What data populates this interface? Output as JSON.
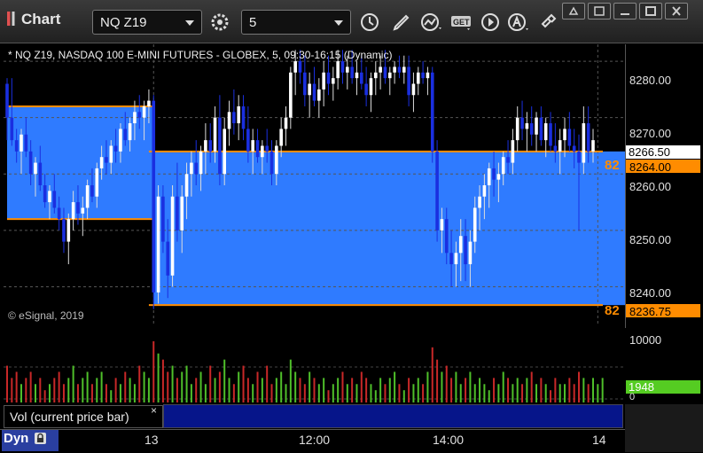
{
  "toolbar": {
    "title": "Chart",
    "symbol": "NQ Z19",
    "interval": "5",
    "buttons": [
      "clock-icon",
      "pencil-icon",
      "study-icon",
      "get-icon",
      "play-icon",
      "alert-icon",
      "link-icon"
    ]
  },
  "chart_info": "* NQ Z19, NASDAQ 100 E-MINI FUTURES - GLOBEX, 5, 09:30-16:15 (Dynamic)",
  "copyright": "© eSignal, 2019",
  "price_axis": {
    "ticks": [
      "8280.00",
      "8270.00",
      "8260.00",
      "8250.00",
      "8240.00"
    ],
    "tags": {
      "last": "8266.50",
      "upper_level": "8264.00",
      "lower_level": "8236.75"
    },
    "level_prefix": "82"
  },
  "volume_axis": {
    "ticks": [
      "10000",
      "0"
    ],
    "current": "1948"
  },
  "volume_legend": "Vol (current price bar)",
  "close_x": "×",
  "time_axis": [
    "13",
    "12:00",
    "14:00",
    "14"
  ],
  "dyn_label": "Dyn",
  "colors": {
    "zone": "#2f7bff",
    "level": "#ff8c00",
    "up": "#ffffff",
    "down": "#1a2fe0",
    "vol_up": "#4fbf2a",
    "vol_down": "#c82828"
  },
  "chart_data": {
    "type": "candlestick",
    "ylim": [
      8233,
      8283
    ],
    "levels": [
      8272,
      8264,
      8252,
      8236.75
    ],
    "zones": [
      {
        "from_bar": 0,
        "to_bar": 31,
        "top": 8272,
        "bottom": 8252
      },
      {
        "from_bar": 31,
        "to_bar": 131,
        "top": 8264,
        "bottom": 8236.75
      }
    ],
    "candles": [
      [
        8276,
        8277,
        8266,
        8270
      ],
      [
        8270,
        8277,
        8265,
        8266
      ],
      [
        8266,
        8268,
        8262,
        8264
      ],
      [
        8264,
        8268,
        8260,
        8267
      ],
      [
        8267,
        8270,
        8263,
        8264
      ],
      [
        8264,
        8266,
        8258,
        8260
      ],
      [
        8260,
        8263,
        8256,
        8262
      ],
      [
        8262,
        8265,
        8257,
        8258
      ],
      [
        8258,
        8260,
        8254,
        8255
      ],
      [
        8255,
        8258,
        8252,
        8257
      ],
      [
        8257,
        8260,
        8253,
        8254
      ],
      [
        8254,
        8256,
        8250,
        8252
      ],
      [
        8252,
        8254,
        8246,
        8248
      ],
      [
        8248,
        8253,
        8244,
        8252
      ],
      [
        8252,
        8257,
        8250,
        8255
      ],
      [
        8255,
        8258,
        8251,
        8253
      ],
      [
        8253,
        8256,
        8249,
        8254
      ],
      [
        8254,
        8259,
        8252,
        8258
      ],
      [
        8258,
        8261,
        8255,
        8256
      ],
      [
        8256,
        8262,
        8254,
        8261
      ],
      [
        8261,
        8265,
        8259,
        8263
      ],
      [
        8263,
        8266,
        8260,
        8262
      ],
      [
        8262,
        8266,
        8260,
        8265
      ],
      [
        8265,
        8268,
        8262,
        8264
      ],
      [
        8264,
        8269,
        8262,
        8268
      ],
      [
        8268,
        8271,
        8265,
        8266
      ],
      [
        8266,
        8270,
        8264,
        8269
      ],
      [
        8269,
        8273,
        8266,
        8271
      ],
      [
        8271,
        8274,
        8268,
        8270
      ],
      [
        8270,
        8273,
        8266,
        8272
      ],
      [
        8272,
        8275,
        8269,
        8273
      ],
      [
        8273,
        8274,
        8236,
        8239
      ],
      [
        8239,
        8258,
        8237,
        8256
      ],
      [
        8256,
        8258,
        8246,
        8248
      ],
      [
        8248,
        8252,
        8238,
        8242
      ],
      [
        8242,
        8258,
        8240,
        8256
      ],
      [
        8256,
        8262,
        8248,
        8250
      ],
      [
        8250,
        8258,
        8246,
        8256
      ],
      [
        8256,
        8262,
        8252,
        8260
      ],
      [
        8260,
        8264,
        8256,
        8262
      ],
      [
        8262,
        8266,
        8258,
        8260
      ],
      [
        8260,
        8265,
        8257,
        8264
      ],
      [
        8264,
        8269,
        8260,
        8266
      ],
      [
        8266,
        8269,
        8262,
        8264
      ],
      [
        8264,
        8272,
        8262,
        8270
      ],
      [
        8270,
        8274,
        8258,
        8260
      ],
      [
        8260,
        8270,
        8258,
        8268
      ],
      [
        8268,
        8273,
        8265,
        8271
      ],
      [
        8271,
        8275,
        8267,
        8269
      ],
      [
        8269,
        8274,
        8266,
        8272
      ],
      [
        8272,
        8274,
        8266,
        8268
      ],
      [
        8268,
        8272,
        8262,
        8264
      ],
      [
        8264,
        8268,
        8260,
        8266
      ],
      [
        8266,
        8268,
        8262,
        8263
      ],
      [
        8263,
        8266,
        8260,
        8265
      ],
      [
        8265,
        8268,
        8262,
        8264
      ],
      [
        8264,
        8266,
        8258,
        8260
      ],
      [
        8260,
        8266,
        8258,
        8265
      ],
      [
        8265,
        8270,
        8263,
        8268
      ],
      [
        8268,
        8272,
        8265,
        8270
      ],
      [
        8270,
        8279,
        8268,
        8278
      ],
      [
        8278,
        8282,
        8274,
        8280
      ],
      [
        8280,
        8282,
        8276,
        8278
      ],
      [
        8278,
        8281,
        8272,
        8274
      ],
      [
        8274,
        8278,
        8270,
        8276
      ],
      [
        8276,
        8279,
        8272,
        8273
      ],
      [
        8273,
        8277,
        8270,
        8275
      ],
      [
        8275,
        8280,
        8272,
        8278
      ],
      [
        8278,
        8281,
        8274,
        8276
      ],
      [
        8276,
        8279,
        8273,
        8277
      ],
      [
        8277,
        8282,
        8275,
        8280
      ],
      [
        8280,
        8282,
        8276,
        8278
      ],
      [
        8278,
        8281,
        8275,
        8279
      ],
      [
        8279,
        8282,
        8276,
        8277
      ],
      [
        8277,
        8280,
        8274,
        8278
      ],
      [
        8278,
        8281,
        8275,
        8276
      ],
      [
        8276,
        8279,
        8272,
        8274
      ],
      [
        8274,
        8278,
        8271,
        8277
      ],
      [
        8277,
        8280,
        8274,
        8278
      ],
      [
        8278,
        8281,
        8275,
        8279
      ],
      [
        8279,
        8282,
        8276,
        8277
      ],
      [
        8277,
        8279,
        8274,
        8278
      ],
      [
        8278,
        8280,
        8276,
        8279
      ],
      [
        8279,
        8281,
        8277,
        8278
      ],
      [
        8278,
        8281,
        8276,
        8279
      ],
      [
        8279,
        8281,
        8272,
        8274
      ],
      [
        8274,
        8278,
        8271,
        8276
      ],
      [
        8276,
        8279,
        8274,
        8278
      ],
      [
        8278,
        8280,
        8276,
        8277
      ],
      [
        8277,
        8279,
        8274,
        8278
      ],
      [
        8278,
        8279,
        8262,
        8264
      ],
      [
        8264,
        8266,
        8248,
        8250
      ],
      [
        8250,
        8254,
        8246,
        8252
      ],
      [
        8252,
        8254,
        8244,
        8246
      ],
      [
        8246,
        8250,
        8240,
        8244
      ],
      [
        8244,
        8248,
        8240,
        8246
      ],
      [
        8246,
        8252,
        8241,
        8249
      ],
      [
        8249,
        8252,
        8241,
        8244
      ],
      [
        8244,
        8250,
        8240,
        8248
      ],
      [
        8248,
        8256,
        8246,
        8254
      ],
      [
        8254,
        8258,
        8250,
        8256
      ],
      [
        8256,
        8260,
        8252,
        8258
      ],
      [
        8258,
        8262,
        8254,
        8261
      ],
      [
        8261,
        8264,
        8256,
        8259
      ],
      [
        8259,
        8262,
        8255,
        8260
      ],
      [
        8260,
        8264,
        8258,
        8263
      ],
      [
        8263,
        8266,
        8260,
        8262
      ],
      [
        8262,
        8268,
        8260,
        8266
      ],
      [
        8266,
        8272,
        8264,
        8270
      ],
      [
        8270,
        8273,
        8266,
        8268
      ],
      [
        8268,
        8271,
        8264,
        8269
      ],
      [
        8269,
        8272,
        8265,
        8267
      ],
      [
        8267,
        8271,
        8264,
        8270
      ],
      [
        8270,
        8272,
        8265,
        8266
      ],
      [
        8266,
        8270,
        8263,
        8269
      ],
      [
        8269,
        8271,
        8264,
        8265
      ],
      [
        8265,
        8269,
        8262,
        8264
      ],
      [
        8264,
        8268,
        8260,
        8266
      ],
      [
        8266,
        8270,
        8263,
        8268
      ],
      [
        8268,
        8271,
        8264,
        8265
      ],
      [
        8265,
        8268,
        8261,
        8264
      ],
      [
        8264,
        8267,
        8250,
        8262
      ],
      [
        8262,
        8272,
        8260,
        8269
      ],
      [
        8269,
        8272,
        8262,
        8264
      ],
      [
        8264,
        8268,
        8262,
        8266
      ]
    ],
    "volume": [
      6,
      4,
      5,
      3,
      4,
      5,
      3,
      4,
      2,
      3,
      4,
      5,
      3,
      4,
      6,
      3,
      4,
      5,
      3,
      4,
      5,
      3,
      2,
      4,
      3,
      5,
      4,
      3,
      6,
      5,
      4,
      10,
      8,
      7,
      5,
      6,
      4,
      5,
      6,
      3,
      4,
      5,
      3,
      6,
      4,
      5,
      7,
      4,
      3,
      5,
      6,
      4,
      3,
      5,
      4,
      6,
      3,
      4,
      5,
      3,
      7,
      5,
      4,
      3,
      5,
      4,
      3,
      4,
      2,
      3,
      4,
      5,
      3,
      4,
      3,
      5,
      4,
      3,
      2,
      4,
      3,
      4,
      5,
      3,
      2,
      4,
      3,
      4,
      3,
      5,
      9,
      7,
      5,
      6,
      4,
      5,
      3,
      4,
      5,
      3,
      4,
      3,
      2,
      4,
      3,
      5,
      4,
      3,
      4,
      3,
      4,
      5,
      3,
      4,
      3,
      2,
      4,
      3,
      3,
      4,
      3,
      5,
      4,
      3,
      4,
      3,
      4
    ]
  }
}
